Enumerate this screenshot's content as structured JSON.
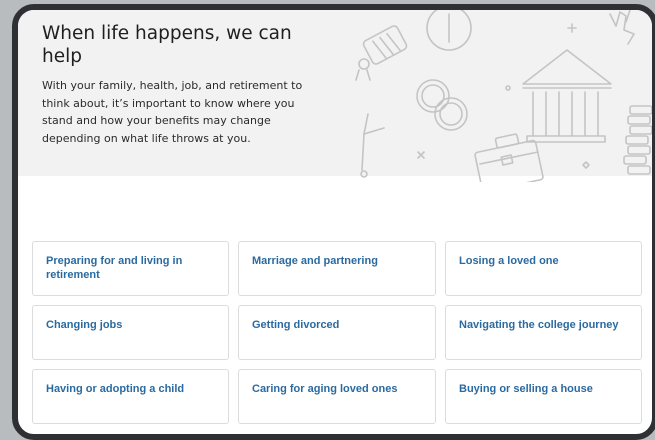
{
  "hero": {
    "title": "When life happens, we can help",
    "body": "With your family, health, job, and retirement to think about, it’s important to know where you stand and how your benefits may change depending on what life throws at you."
  },
  "life_events": [
    "Preparing for and living in retirement",
    "Marriage and partnering",
    "Losing a loved one",
    "Changing jobs",
    "Getting divorced",
    "Navigating the college journey",
    "Having or adopting a child",
    "Caring for aging loved ones",
    "Buying or selling a house"
  ],
  "colors": {
    "link": "#2a6aa0",
    "hero_background": "#f2f2f2",
    "illustration_stroke": "#c4c4c4"
  }
}
